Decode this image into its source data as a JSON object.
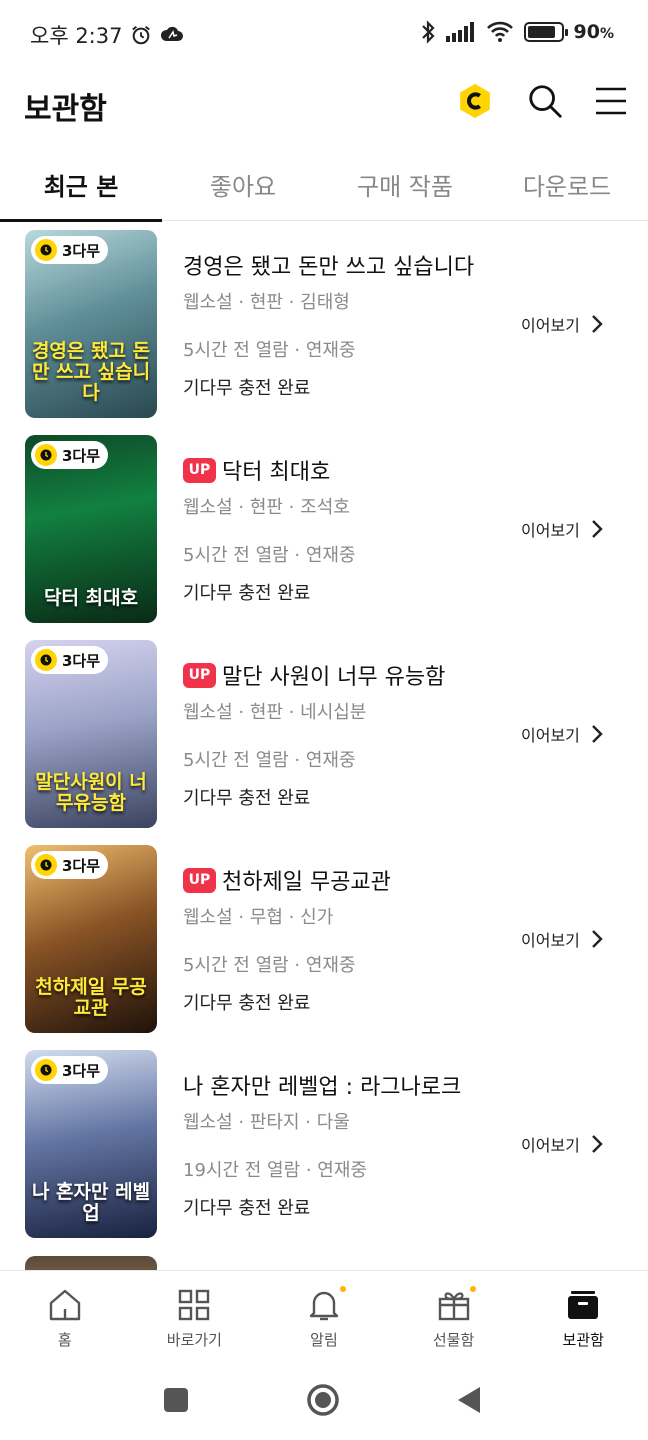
{
  "status": {
    "time": "오후 2:37",
    "battery": "90",
    "battery_unit": "%",
    "battery_level": 0.9
  },
  "header": {
    "title": "보관함"
  },
  "tabs": [
    {
      "label": "최근 본",
      "active": true
    },
    {
      "label": "좋아요",
      "active": false
    },
    {
      "label": "구매 작품",
      "active": false
    },
    {
      "label": "다운로드",
      "active": false
    }
  ],
  "items": [
    {
      "wait_badge": "3다무",
      "up": false,
      "title": "경영은 됐고 돈만 쓰고 싶습니다",
      "meta": "웹소설 · 현판 · 김태형",
      "read_info": "5시간 전 열람 · 연재중",
      "charge": "기다무 충전 완료",
      "continue_label": "이어보기",
      "cover_caption": "경영은 됐고 돈만 쓰고 싶습니다",
      "cover_colors": [
        "#9fc3c9",
        "#3f6f7a",
        "#24434a"
      ]
    },
    {
      "wait_badge": "3다무",
      "up": true,
      "up_label": "UP",
      "title": "닥터 최대호",
      "meta": "웹소설 · 현판 · 조석호",
      "read_info": "5시간 전 열람 · 연재중",
      "charge": "기다무 충전 완료",
      "continue_label": "이어보기",
      "cover_caption": "닥터 최대호",
      "cover_colors": [
        "#0b3a1f",
        "#116b35",
        "#0a2615"
      ]
    },
    {
      "wait_badge": "3다무",
      "up": true,
      "up_label": "UP",
      "title": "말단 사원이 너무 유능함",
      "meta": "웹소설 · 현판 · 네시십분",
      "read_info": "5시간 전 열람 · 연재중",
      "charge": "기다무 충전 완료",
      "continue_label": "이어보기",
      "cover_caption": "말단사원이 너무유능함",
      "cover_colors": [
        "#c9c6e8",
        "#8a93b8",
        "#3b4360"
      ]
    },
    {
      "wait_badge": "3다무",
      "up": true,
      "up_label": "UP",
      "title": "천하제일 무공교관",
      "meta": "웹소설 · 무협 · 신가",
      "read_info": "5시간 전 열람 · 연재중",
      "charge": "기다무 충전 완료",
      "continue_label": "이어보기",
      "cover_caption": "천하제일 무공교관",
      "cover_colors": [
        "#e8b060",
        "#7a4a22",
        "#1e120a"
      ]
    },
    {
      "wait_badge": "3다무",
      "up": false,
      "title": "나 혼자만 레벨업 : 라그나로크",
      "meta": "웹소설 · 판타지 · 다울",
      "read_info": "19시간 전 열람 · 연재중",
      "charge": "기다무 충전 완료",
      "continue_label": "이어보기",
      "cover_caption": "나 혼자만 레벨업",
      "cover_colors": [
        "#c9d6ea",
        "#5a6c9a",
        "#1a2240"
      ]
    }
  ],
  "bottom_nav": [
    {
      "label": "홈",
      "icon": "home-icon",
      "dot": false
    },
    {
      "label": "바로가기",
      "icon": "grid-icon",
      "dot": false
    },
    {
      "label": "알림",
      "icon": "bell-icon",
      "dot": true
    },
    {
      "label": "선물함",
      "icon": "gift-icon",
      "dot": true
    },
    {
      "label": "보관함",
      "icon": "archive-icon",
      "dot": false
    }
  ],
  "colors": {
    "accent_yellow": "#ffd400",
    "up_red": "#f0324b",
    "notification_dot": "#ffb800"
  }
}
